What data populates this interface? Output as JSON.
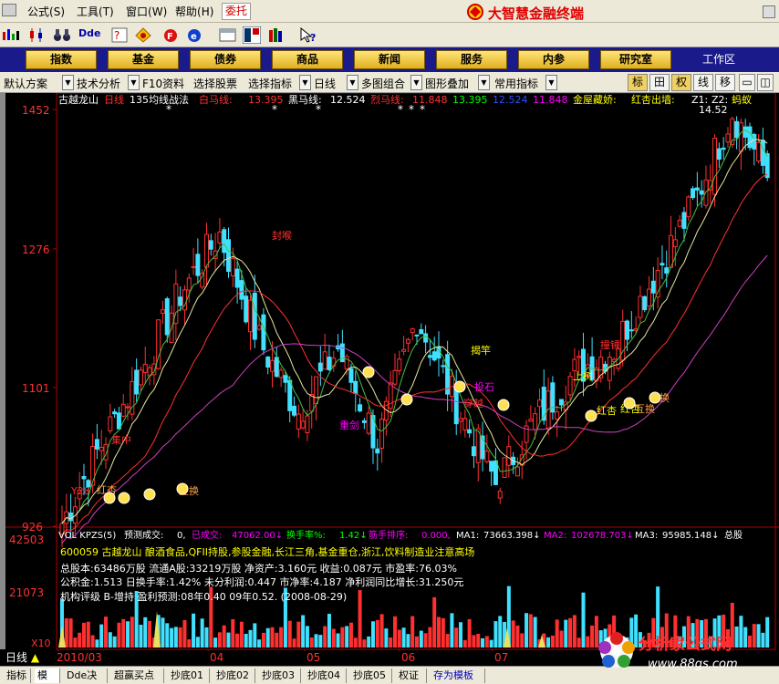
{
  "menu": {
    "items": [
      "公式",
      "工具",
      "窗口",
      "帮助"
    ],
    "shortcuts": [
      "(S)",
      "(T)",
      "(W)",
      "(H)"
    ],
    "entrust_label": "委托",
    "brand_title": "大智慧金融终端"
  },
  "nav": {
    "tabs": [
      "指数",
      "基金",
      "债券",
      "商品",
      "新闻",
      "服务",
      "内参",
      "研究室"
    ],
    "workarea_label": "工作区"
  },
  "options": {
    "scheme": "默认方案",
    "tech_analysis": "技术分析",
    "f10": "F10资料",
    "pick_stock": "选择股票",
    "pick_index": "选择指标",
    "period": "日线",
    "multi_chart": "多图组合",
    "overlay": "图形叠加",
    "common_index": "常用指标",
    "right_buttons": [
      "标",
      "田",
      "权",
      "线",
      "移"
    ]
  },
  "price_pane": {
    "title_parts": [
      {
        "text": "古越龙山",
        "color": "#ffffff"
      },
      {
        "text": "日线",
        "color": "#ff3030"
      },
      {
        "text": "135均线战法",
        "color": "#ffffff"
      },
      {
        "text": "白马线:",
        "color": "#ff3030"
      },
      {
        "text": "13.395",
        "color": "#ff3030"
      },
      {
        "text": "黑马线:",
        "color": "#ffffff"
      },
      {
        "text": "12.524",
        "color": "#ffffff"
      },
      {
        "text": "烈马线:",
        "color": "#ff3030"
      },
      {
        "text": "11.848",
        "color": "#ff3030"
      },
      {
        "text": "13.395",
        "color": "#00ff00"
      },
      {
        "text": "12.524",
        "color": "#3050ff"
      },
      {
        "text": "11.848",
        "color": "#ff00ff"
      },
      {
        "text": "金屋藏娇:",
        "color": "#ffff00"
      },
      {
        "text": "红杏出墙:",
        "color": "#ffff00"
      },
      {
        "text": "Z1:",
        "color": "#ffffff"
      },
      {
        "text": "Z2:",
        "color": "#ffffff"
      },
      {
        "text": "蚂蚁",
        "color": "#ffff00"
      }
    ],
    "y_labels": [
      "1452",
      "1276",
      "1101",
      "926"
    ],
    "high_label": "14.52",
    "annotations": [
      {
        "text": "封喉",
        "color": "#ff3030"
      },
      {
        "text": "揭竿",
        "color": "#ffff00"
      },
      {
        "text": "上树",
        "color": "#ffff00"
      },
      {
        "text": "重剑",
        "color": "#ff00ff"
      },
      {
        "text": "投石",
        "color": "#ff00ff"
      },
      {
        "text": "穿越",
        "color": "#ff3030"
      },
      {
        "text": "撞锤",
        "color": "#ff3030"
      },
      {
        "text": "集中",
        "color": "#ff3030"
      },
      {
        "text": "互换",
        "color": "#ffa040"
      },
      {
        "text": "互换",
        "color": "#ffa040"
      },
      {
        "text": "互换",
        "color": "#ffa040"
      },
      {
        "text": "红杏",
        "color": "#ffff00"
      },
      {
        "text": "红杏",
        "color": "#ffff00"
      },
      {
        "text": "红杏",
        "color": "#ffa040"
      },
      {
        "text": "Y28",
        "color": "#ff3030"
      }
    ]
  },
  "volume_pane": {
    "title_parts": [
      {
        "text": "VOL KPZS(5)",
        "color": "#ffffff"
      },
      {
        "text": "预测成交:",
        "color": "#ffffff"
      },
      {
        "text": "0,",
        "color": "#ffffff"
      },
      {
        "text": "已成交:",
        "color": "#ff00ff"
      },
      {
        "text": "47062.00↓",
        "color": "#ff00ff"
      },
      {
        "text": "换手率%:",
        "color": "#00ff00"
      },
      {
        "text": "1.42↓",
        "color": "#00ff00"
      },
      {
        "text": "筋手排序:",
        "color": "#ff00ff"
      },
      {
        "text": "0.000,",
        "color": "#ff00ff"
      },
      {
        "text": "MA1:",
        "color": "#ffffff"
      },
      {
        "text": "73663.398↓",
        "color": "#ffffff"
      },
      {
        "text": "MA2:",
        "color": "#ff00ff"
      },
      {
        "text": "102678.703↓",
        "color": "#ff00ff"
      },
      {
        "text": "MA3:",
        "color": "#ffffff"
      },
      {
        "text": "95985.148↓",
        "color": "#ffffff"
      },
      {
        "text": "总股",
        "color": "#ffffff"
      }
    ],
    "y_labels": [
      "42503",
      "21073",
      "X10"
    ],
    "info_lines": [
      {
        "text": "600059 古越龙山 酿酒食品,QFII持股,参股金融,长江三角,基金重仓,浙江,饮料制造业注意高场",
        "color": "#ffff00"
      },
      {
        "text": "总股本:63486万股 流通A股:33219万股  净资产:3.160元  收益:0.087元  市盈率:76.03%",
        "color": "#ffffff"
      },
      {
        "text": "公积金:1.513  日换手率:1.42%  未分利润:0.447  市净率:4.187  净利润同比增长:31.250元",
        "color": "#ffffff"
      },
      {
        "text": "机构评级  B-增持  盈利预测:08年0.40 09年0.52. (2008-08-29)",
        "color": "#ffffff"
      }
    ],
    "x_labels": [
      "2010/03",
      "04",
      "05",
      "06",
      "07"
    ]
  },
  "status": {
    "period_label": "日线",
    "tabs": [
      "指标",
      "模板",
      "Dde决策",
      "超赢买点",
      "抄底01",
      "抄底02",
      "抄底03",
      "抄底04",
      "抄底05",
      "权证",
      "存为模板"
    ]
  },
  "watermark": {
    "title": "分析家公式网",
    "url": "www.88gs.com"
  },
  "colors": {
    "up": "#ff3030",
    "down": "#40e0ff",
    "ma_white": "#e8e8a0",
    "ma_red": "#ff3030",
    "ma_pink": "#d040c0",
    "ma_green": "#40c040",
    "ma_blue": "#3050ff",
    "ma_yellow": "#e8e060",
    "axis_red": "#b00000"
  },
  "chart_data": {
    "type": "candlestick",
    "y_range_price": [
      9.26,
      14.52
    ],
    "y_range_volume": [
      0,
      42503
    ],
    "months": [
      "2010/03",
      "04",
      "05",
      "06",
      "07"
    ],
    "price_axis_ticks": [
      14.52,
      12.76,
      11.01,
      9.26
    ],
    "volume_axis_ticks": [
      42503,
      21073
    ],
    "trend_segments": [
      [
        9.3,
        10.3
      ],
      [
        10.3,
        11.2
      ],
      [
        11.2,
        12.2
      ],
      [
        12.2,
        12.95
      ],
      [
        12.95,
        11.6
      ],
      [
        11.6,
        10.7
      ],
      [
        10.7,
        11.5
      ],
      [
        11.5,
        10.3
      ],
      [
        10.3,
        11.9
      ],
      [
        11.9,
        10.8
      ],
      [
        10.8,
        9.8
      ],
      [
        9.8,
        10.6
      ],
      [
        10.6,
        11.2
      ],
      [
        11.2,
        11.5
      ],
      [
        11.5,
        12.4
      ],
      [
        12.4,
        13.3
      ],
      [
        13.3,
        14.5
      ],
      [
        14.5,
        13.6
      ]
    ]
  }
}
